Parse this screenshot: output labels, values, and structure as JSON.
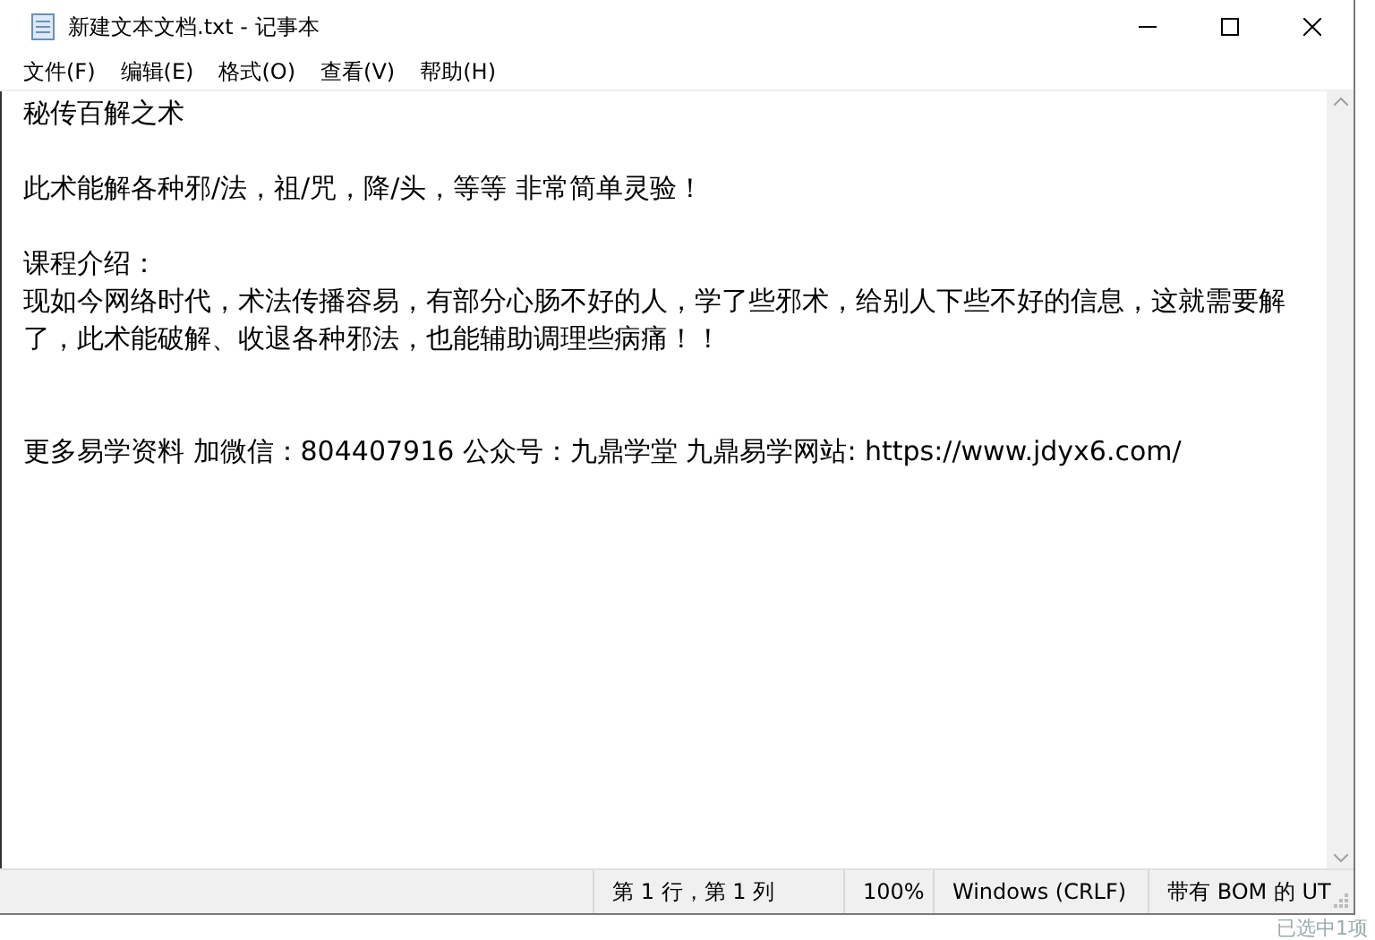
{
  "window": {
    "title": "新建文本文档.txt - 记事本"
  },
  "menu": [
    "文件(F)",
    "编辑(E)",
    "格式(O)",
    "查看(V)",
    "帮助(H)"
  ],
  "document": {
    "lines": [
      {
        "text": "秘传百解之术",
        "kind": "plain"
      },
      {
        "text": "此术能解各种邪/法，祖/咒，降/头，等等 非常简单灵验！",
        "kind": "spaced"
      },
      {
        "text": "课程介绍：",
        "kind": "spaced"
      },
      {
        "text": "现如今网络时代，术法传播容易，有部分心肠不好的人，学了些邪术，给别人下些不好的信息，这就需要解了，此术能破解、收退各种邪法，也能辅助调理些病痛！！",
        "kind": "plain"
      },
      {
        "text": "更多易学资料 加微信：804407916 公众号：九鼎学堂 九鼎易学网站: https://www.jdyx6.com/",
        "kind": "farspaced"
      }
    ]
  },
  "status_bar": [
    "第 1 行，第 1 列",
    "100%",
    "Windows (CRLF)",
    "带有 BOM 的 UT"
  ],
  "background_text": "已选中1项"
}
